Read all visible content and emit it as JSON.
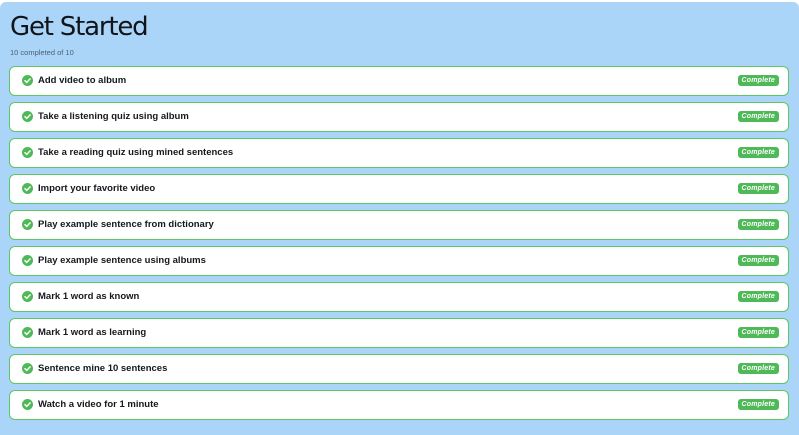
{
  "header": {
    "title": "Get Started",
    "progress_text": "10 completed of 10"
  },
  "status_label": "Complete",
  "tasks": [
    {
      "label": "Add video to album",
      "status": "Complete",
      "icon": "check-circle-icon"
    },
    {
      "label": "Take a listening quiz using album",
      "status": "Complete",
      "icon": "check-circle-icon"
    },
    {
      "label": "Take a reading quiz using mined sentences",
      "status": "Complete",
      "icon": "check-circle-icon"
    },
    {
      "label": "Import your favorite video",
      "status": "Complete",
      "icon": "check-circle-icon"
    },
    {
      "label": "Play example sentence from dictionary",
      "status": "Complete",
      "icon": "check-circle-icon"
    },
    {
      "label": "Play example sentence using albums",
      "status": "Complete",
      "icon": "check-circle-icon"
    },
    {
      "label": "Mark 1 word as known",
      "status": "Complete",
      "icon": "check-circle-icon"
    },
    {
      "label": "Mark 1 word as learning",
      "status": "Complete",
      "icon": "check-circle-icon"
    },
    {
      "label": "Sentence mine 10 sentences",
      "status": "Complete",
      "icon": "check-circle-icon"
    },
    {
      "label": "Watch a video for 1 minute",
      "status": "Complete",
      "icon": "check-circle-icon"
    }
  ],
  "colors": {
    "background": "#aad4f8",
    "card_border": "#5cc861",
    "accent_green": "#4fb957",
    "text_dark": "#15181c"
  }
}
